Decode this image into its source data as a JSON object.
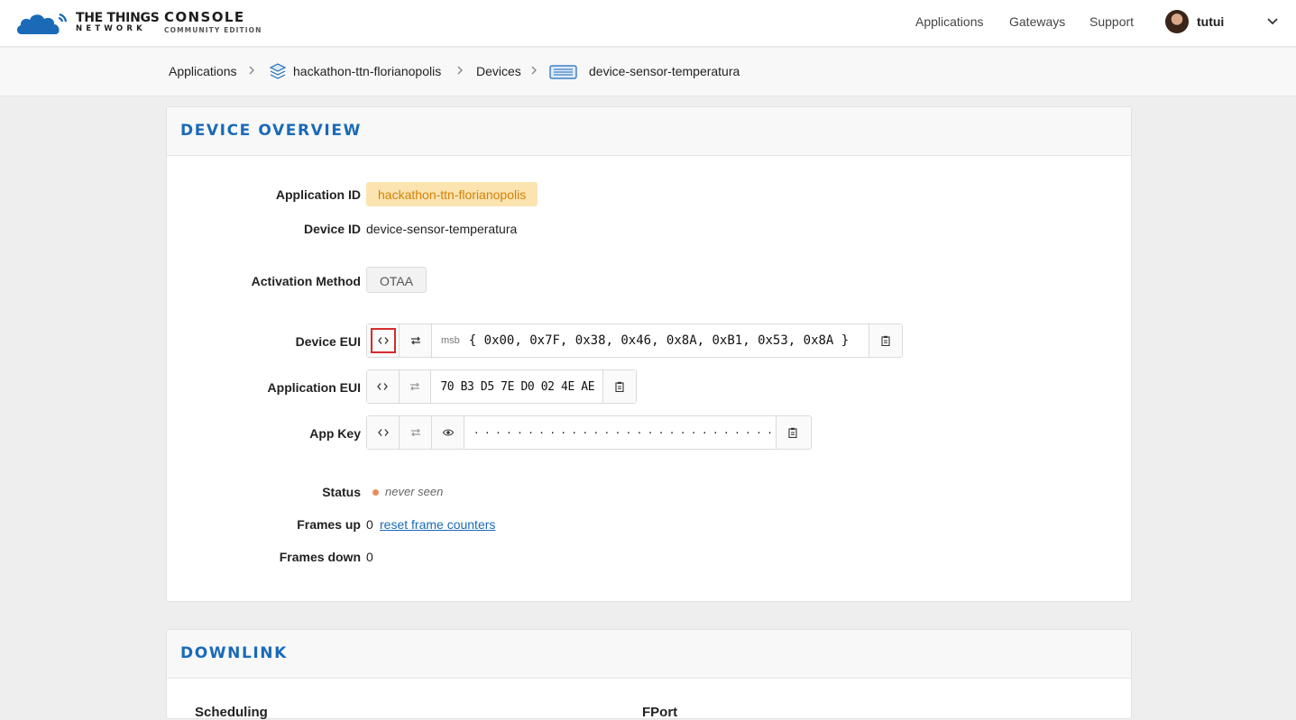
{
  "brand": {
    "name_line1": "THE THINGS",
    "name_line2": "NETWORK",
    "console_title": "CONSOLE",
    "console_subtitle": "COMMUNITY EDITION"
  },
  "nav": {
    "applications": "Applications",
    "gateways": "Gateways",
    "support": "Support",
    "username": "tutui"
  },
  "breadcrumb": {
    "applications": "Applications",
    "app_id": "hackathon-ttn-florianopolis",
    "devices": "Devices",
    "device_id": "device-sensor-temperatura"
  },
  "overview": {
    "title": "DEVICE OVERVIEW",
    "application_id_label": "Application ID",
    "application_id": "hackathon-ttn-florianopolis",
    "device_id_label": "Device ID",
    "device_id": "device-sensor-temperatura",
    "activation_label": "Activation Method",
    "activation": "OTAA",
    "device_eui_label": "Device EUI",
    "device_eui_order": "msb",
    "device_eui": "{ 0x00, 0x7F, 0x38, 0x46, 0x8A, 0xB1, 0x53, 0x8A }",
    "app_eui_label": "Application EUI",
    "app_eui": "70 B3 D5 7E D0 02 4E AE",
    "app_key_label": "App Key",
    "app_key": "· · · · · · · · · · · · · · · · · · · · · · · · · · · · · · · ·",
    "status_label": "Status",
    "status": "never seen",
    "status_color": "#e98e5a",
    "frames_up_label": "Frames up",
    "frames_up": "0",
    "reset_link": "reset frame counters",
    "frames_down_label": "Frames down",
    "frames_down": "0"
  },
  "downlink": {
    "title": "DOWNLINK",
    "scheduling_label": "Scheduling",
    "fport_label": "FPort"
  },
  "colors": {
    "accent": "#1a6ab8",
    "badge_bg": "#fbe4b0",
    "badge_text": "#d2820b",
    "highlight": "#d62b2b"
  },
  "icons": [
    "cloud-logo-icon",
    "chevron-right-icon",
    "application-stack-icon",
    "device-icon",
    "chevron-down-icon",
    "code-brackets-icon",
    "swap-icon",
    "eye-icon",
    "clipboard-icon"
  ]
}
